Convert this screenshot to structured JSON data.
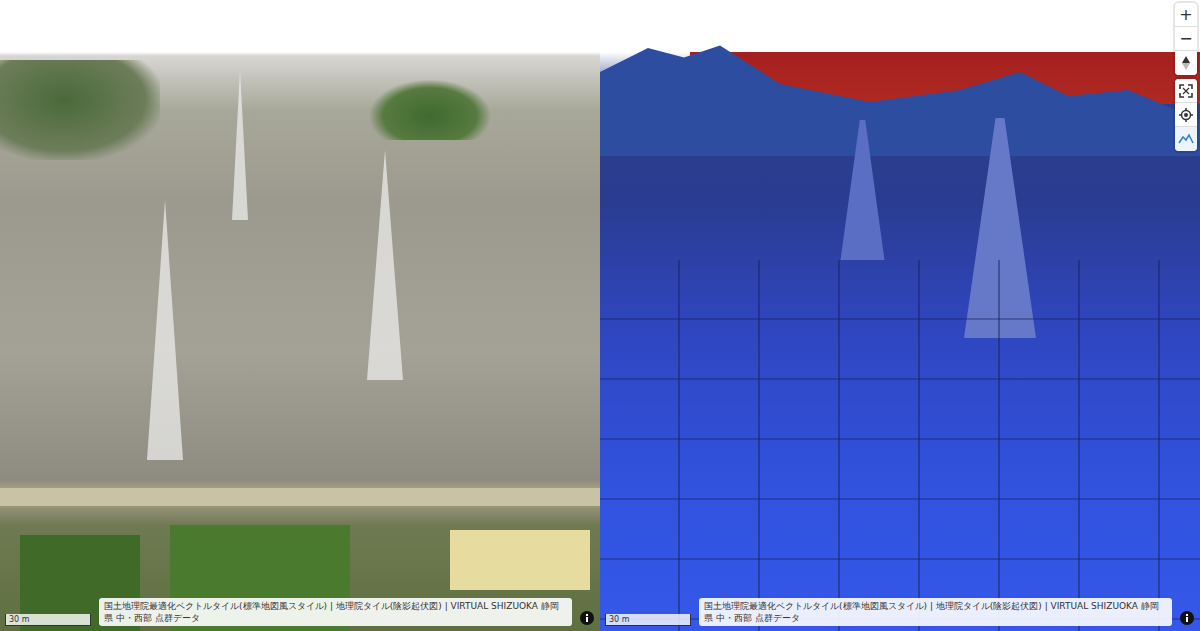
{
  "panes": [
    {
      "name": "point-cloud",
      "scale": {
        "label": "30 m"
      },
      "attribution": "国土地理院最適化ベクトルタイル(標準地図風スタイル) | 地理院タイル(陰影起伏図) | VIRTUAL SHIZUOKA 静岡県 中・西部 点群データ"
    },
    {
      "name": "elevation",
      "scale": {
        "label": "30 m"
      },
      "attribution": "国土地理院最適化ベクトルタイル(標準地図風スタイル) | 地理院タイル(陰影起伏図) | VIRTUAL SHIZUOKA 静岡県 中・西部 点群データ"
    }
  ],
  "controls": [
    {
      "group": 1,
      "kind": "zoom-in",
      "label": "+",
      "active": false
    },
    {
      "group": 1,
      "kind": "zoom-out",
      "label": "−",
      "active": false
    },
    {
      "group": 1,
      "kind": "compass",
      "active": false
    },
    {
      "group": 2,
      "kind": "fullscreen",
      "active": false
    },
    {
      "group": 2,
      "kind": "locate",
      "active": false
    },
    {
      "group": 2,
      "kind": "terrain",
      "active": true
    }
  ]
}
